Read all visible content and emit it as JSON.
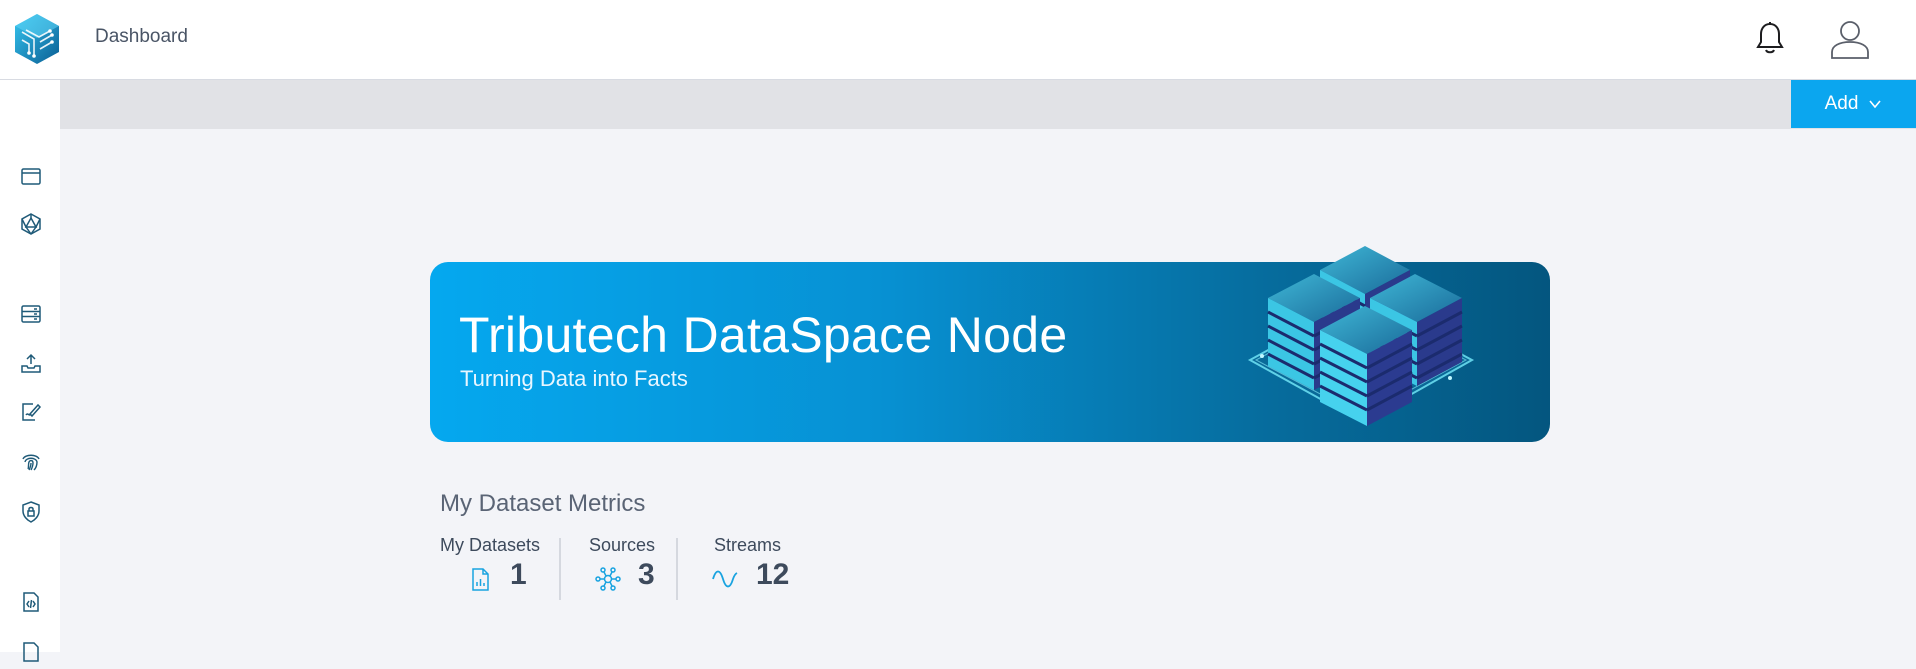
{
  "header": {
    "title": "Dashboard",
    "logo_icon": "tributech-logo-icon",
    "notifications_icon": "bell-icon",
    "user_icon": "user-avatar-icon"
  },
  "sidebar": {
    "items": [
      {
        "icon": "window-icon"
      },
      {
        "icon": "network-hexagon-icon"
      },
      {
        "icon": "storage-icon"
      },
      {
        "icon": "inbox-upload-icon"
      },
      {
        "icon": "document-sign-icon"
      },
      {
        "icon": "fingerprint-icon"
      },
      {
        "icon": "shield-lock-icon"
      },
      {
        "icon": "code-file-icon"
      },
      {
        "icon": "file-icon"
      }
    ]
  },
  "toolbar": {
    "add_label": "Add"
  },
  "hero": {
    "title": "Tributech DataSpace Node",
    "subtitle": "Turning Data into Facts",
    "image_icon": "server-racks-illustration"
  },
  "metrics": {
    "title": "My Dataset Metrics",
    "items": [
      {
        "label": "My Datasets",
        "value": "1",
        "icon": "chart-file-icon"
      },
      {
        "label": "Sources",
        "value": "3",
        "icon": "network-nodes-icon"
      },
      {
        "label": "Streams",
        "value": "12",
        "icon": "sine-wave-icon"
      }
    ]
  },
  "colors": {
    "accent": "#0ba6ef",
    "hero_start": "#05a8ef",
    "hero_end": "#04567f",
    "text": "#3d4a5c",
    "background": "#f3f4f8",
    "sidebar_icon": "#1f5a78"
  }
}
